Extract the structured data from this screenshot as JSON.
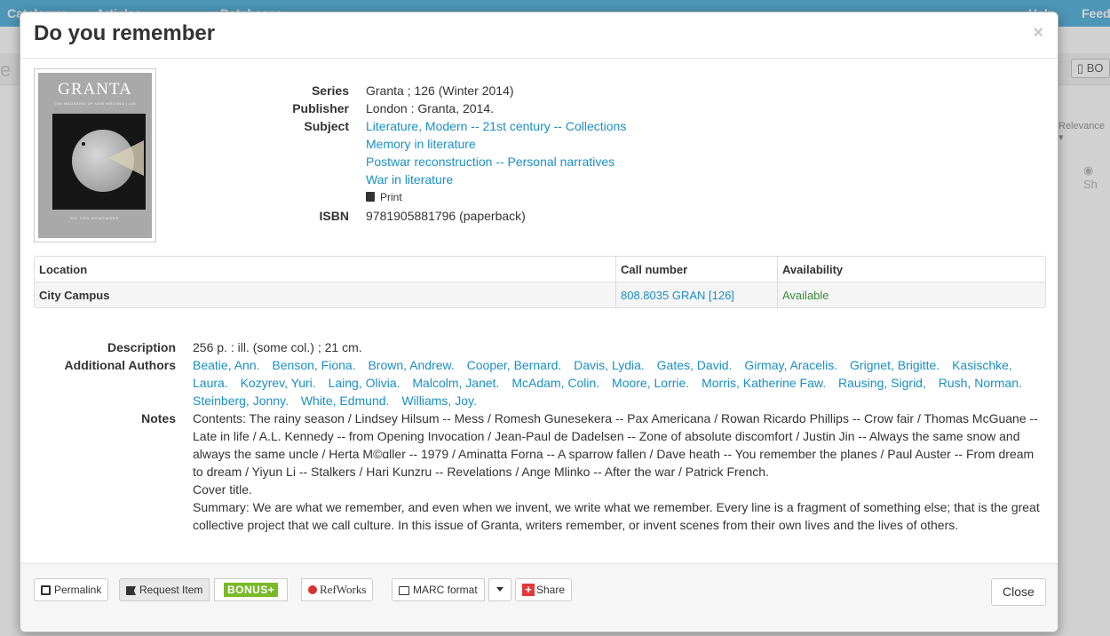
{
  "background": {
    "nav_items": [
      "Catalogue",
      "Articles",
      "Databases",
      "Help",
      "Feedback"
    ],
    "nav_visible": [
      "Catalogue",
      "Articles",
      "Databases",
      "Help",
      "Feed"
    ],
    "bo_label": "BO",
    "relevance_label": "Relevance",
    "show_label": "Sh",
    "e_label": "e"
  },
  "modal": {
    "title": "Do you remember",
    "close_symbol": "×",
    "cover": {
      "word": "GRANTA",
      "subtitle": "THE MAGAZINE OF NEW WRITING | 126",
      "bottom": "DO YOU REMEMBER"
    },
    "metadata": {
      "series_label": "Series",
      "series_value": "Granta ;  126 (Winter 2014)",
      "publisher_label": "Publisher",
      "publisher_value": "London : Granta, 2014.",
      "subject_label": "Subject",
      "subjects": [
        "Literature, Modern -- 21st century -- Collections",
        "Memory in literature",
        "Postwar reconstruction -- Personal narratives",
        "War in literature"
      ],
      "print_label": "Print",
      "isbn_label": "ISBN",
      "isbn_value": "9781905881796 (paperback)"
    },
    "holdings": {
      "columns": [
        "Location",
        "Call number",
        "Availability"
      ],
      "rows": [
        {
          "location": "City Campus",
          "call_number": "808.8035 GRAN [126]",
          "availability": "Available"
        }
      ]
    },
    "details": {
      "description_label": "Description",
      "description_value": "256 p. : ill. (some col.) ; 21 cm.",
      "authors_label": "Additional Authors",
      "authors": [
        "Beatie, Ann.",
        "Benson, Fiona.",
        "Brown, Andrew.",
        "Cooper, Bernard.",
        "Davis, Lydia.",
        "Gates, David.",
        "Girmay, Aracelis.",
        "Grignet, Brigitte.",
        "Kasischke, Laura.",
        "Kozyrev, Yuri.",
        "Laing, Olivia.",
        "Malcolm, Janet.",
        "McAdam, Colin.",
        "Moore, Lorrie.",
        "Morris, Katherine Faw.",
        "Rausing, Sigrid,",
        "Rush, Norman.",
        "Steinberg, Jonny.",
        "White, Edmund.",
        "Williams, Joy."
      ],
      "notes_label": "Notes",
      "notes": [
        "Contents: The rainy season / Lindsey Hilsum -- Mess / Romesh Gunesekera -- Pax Americana / Rowan Ricardo Phillips -- Crow fair / Thomas McGuane -- Late in life / A.L. Kennedy -- from Opening Invocation / Jean-Paul de Dadelsen -- Zone of absolute discomfort / Justin Jin -- Always the same snow and always the same uncle / Herta M©ɑller -- 1979 / Aminatta Forna -- A sparrow fallen / Dave heath -- You remember the planes / Paul Auster -- From dream to dream / Yiyun Li -- Stalkers / Hari Kunzru -- Revelations / Ange Mlinko -- After the war / Patrick French.",
        "Cover title.",
        "Summary: We are what we remember, and even when we invent, we write what we remember. Every line is a fragment of something else; that is the great collective project that we call culture. In this issue of Granta, writers remember, or invent scenes from their own lives and the lives of others."
      ]
    },
    "footer": {
      "permalink_label": "Permalink",
      "request_label": "Request Item",
      "bonus_label": "BONUS+",
      "refworks_label": "RefWorks",
      "marc_label": "MARC format",
      "share_label": "Share",
      "close_label": "Close"
    }
  }
}
